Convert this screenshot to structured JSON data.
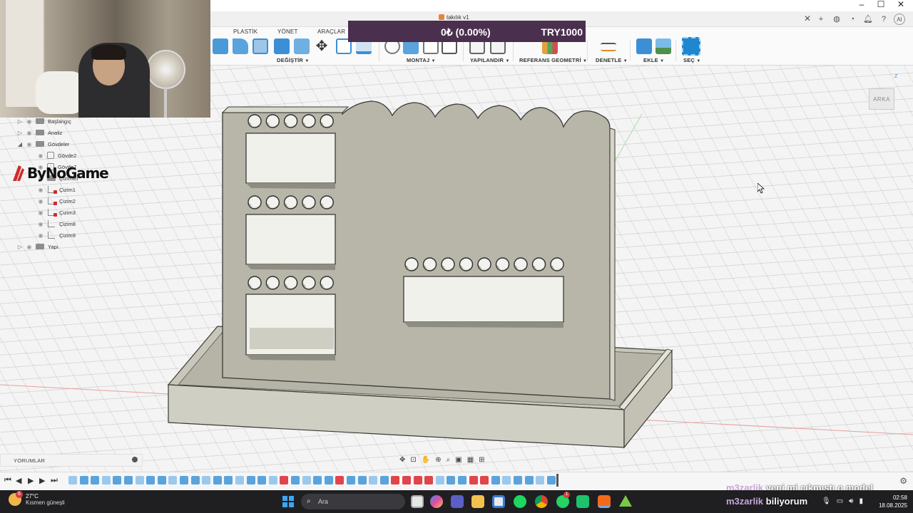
{
  "app": {
    "document_title": "takılık v1",
    "ribbon_tabs": [
      "PLASTİK",
      "YÖNET",
      "ARAÇLAR"
    ],
    "ribbon_groups": [
      "DEĞİŞTİR",
      "MONTAJ",
      "YAPILANDIR",
      "REFERANS GEOMETRİ",
      "DENETLE",
      "EKLE",
      "SEÇ"
    ],
    "tabbar_user_initials": "AI"
  },
  "banner": {
    "amount": "0₺ (0.00%)",
    "goal": "TRY1000"
  },
  "browser": {
    "items": [
      {
        "label": "Başlangıç",
        "type": "folder",
        "expander": "▷"
      },
      {
        "label": "Analiz",
        "type": "folder",
        "expander": "▷"
      },
      {
        "label": "Gövdeler",
        "type": "folder",
        "expander": "◢"
      },
      {
        "label": "Gövde2",
        "type": "body",
        "expander": ""
      },
      {
        "label": "Gövde7",
        "type": "body",
        "expander": ""
      },
      {
        "label": "Çizimler",
        "type": "folder",
        "expander": ""
      },
      {
        "label": "Çizim1",
        "type": "sketch-red",
        "expander": ""
      },
      {
        "label": "Çizim2",
        "type": "sketch-red",
        "expander": ""
      },
      {
        "label": "Çizim3",
        "type": "sketch-red",
        "expander": ""
      },
      {
        "label": "Çizim8",
        "type": "sketch",
        "expander": ""
      },
      {
        "label": "Çizim9",
        "type": "sketch",
        "expander": ""
      },
      {
        "label": "Yapı",
        "type": "folder",
        "expander": "▷"
      }
    ]
  },
  "logo": {
    "text": "ByNoGame"
  },
  "viewcube": {
    "face": "ARKA",
    "axis": "Z"
  },
  "comments": {
    "label": "YORUMLAR"
  },
  "chat": [
    {
      "user": "m3zarlik",
      "message": "yeni mi çıkmıştı o model"
    },
    {
      "user": "m3zarlik",
      "message": "biliyorum"
    }
  ],
  "taskbar": {
    "weather_temp": "27°C",
    "weather_condition": "Kısmen güneşli",
    "weather_badge": "6",
    "search_placeholder": "Ara",
    "whatsapp_badge": "1",
    "time": "02:58",
    "date": "18.08.2025"
  },
  "colors": {
    "model_face": "#b9b8ab",
    "model_side": "#cfcfc2",
    "model_edge": "#3a3a36",
    "banner_bg": "#4b2f4e",
    "taskbar_bg": "#1f1f22",
    "accent_blue": "#3c8fd6"
  }
}
